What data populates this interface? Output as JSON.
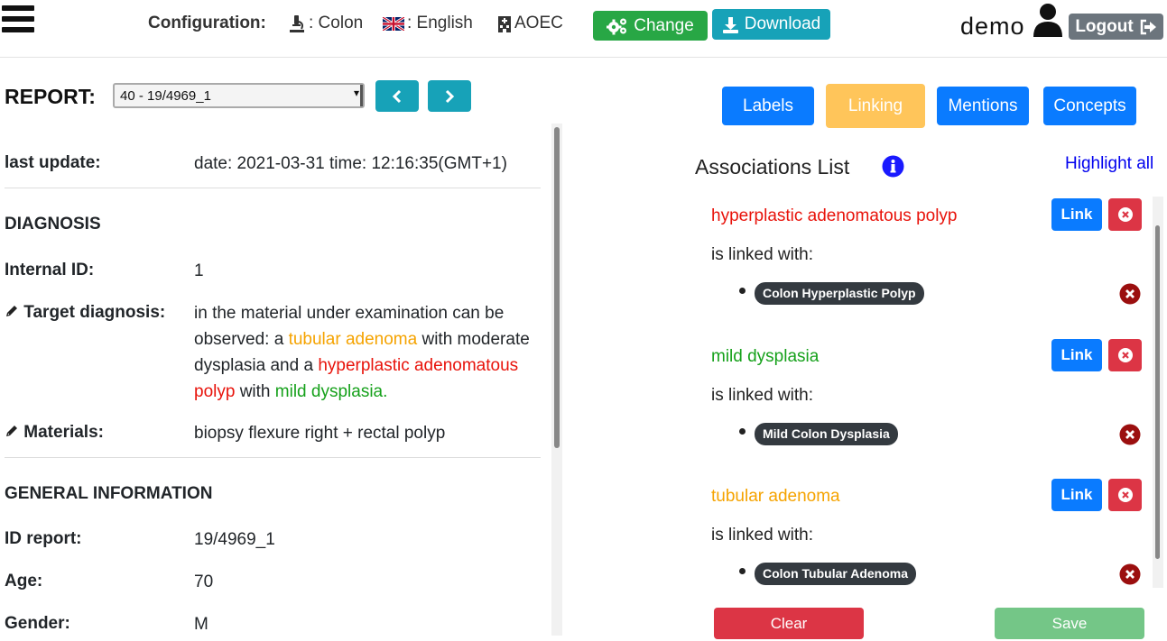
{
  "header": {
    "config_label": "Configuration:",
    "usecase": ": Colon",
    "language": ": English",
    "institute": "AOEC",
    "change_label": "Change",
    "download_label": "Download",
    "username": "demo",
    "logout_label": "Logout",
    "colors": {
      "change": "#28a745",
      "download": "#17a2b8",
      "logout": "#6c757d"
    }
  },
  "report_selector": {
    "label": "REPORT:",
    "selected": "40 - 19/4969_1"
  },
  "report": {
    "last_update_key": "last update:",
    "last_update_value": "date: 2021-03-31 time: 12:16:35(GMT+1)",
    "diagnosis_heading": "DIAGNOSIS",
    "internal_id_key": "Internal ID:",
    "internal_id_value": "1",
    "target_key": "Target diagnosis:",
    "target_text": {
      "p1": "in the material under examination can be observed: a ",
      "m1": "tubular adenoma",
      "p2": " with moderate dysplasia and a ",
      "m2": "hyperplastic adenomatous polyp",
      "p3": " with ",
      "m3": "mild dysplasia."
    },
    "materials_key": "Materials:",
    "materials_value": "biopsy flexure right + rectal polyp",
    "general_heading": "GENERAL INFORMATION",
    "id_report_key": "ID report:",
    "id_report_value": "19/4969_1",
    "age_key": "Age:",
    "age_value": "70",
    "gender_key": "Gender:",
    "gender_value": "M"
  },
  "tabs": {
    "labels": "Labels",
    "linking": "Linking",
    "mentions": "Mentions",
    "concepts": "Concepts",
    "active": "Linking"
  },
  "associations": {
    "title": "Associations List",
    "highlight_all": "Highlight all",
    "linked_with": "is linked with:",
    "link_label": "Link",
    "items": [
      {
        "term": "hyperplastic adenomatous polyp",
        "color": "#e8130b",
        "concept": "Colon Hyperplastic Polyp"
      },
      {
        "term": "mild dysplasia",
        "color": "#16a11b",
        "concept": "Mild Colon Dysplasia"
      },
      {
        "term": "tubular adenoma",
        "color": "#f5a300",
        "concept": "Colon Tubular Adenoma"
      }
    ]
  },
  "footer": {
    "clear_label": "Clear",
    "save_label": "Save"
  }
}
